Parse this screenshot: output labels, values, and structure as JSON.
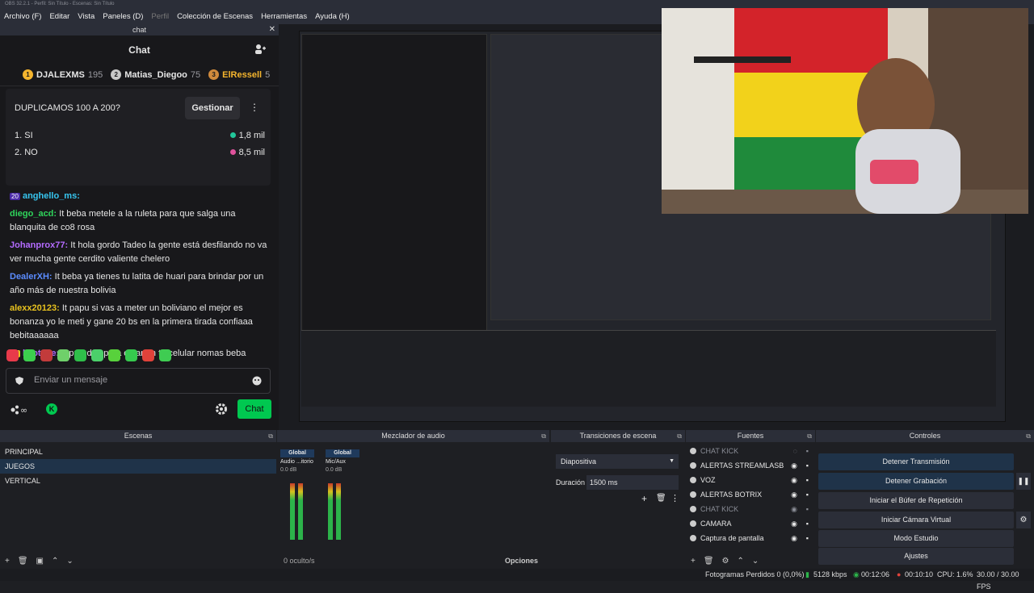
{
  "window_title": "OBS 32.2.1 - Perfil: Sin Título - Escenas: Sin Título",
  "menu": [
    "Archivo (F)",
    "Editar",
    "Vista",
    "Paneles (D)",
    "Perfil",
    "Colección de Escenas",
    "Herramientas",
    "Ayuda (H)"
  ],
  "chat_dock": {
    "dock_title": "chat",
    "header": "Chat",
    "leaderboard": [
      {
        "rank": "1",
        "name": "DJALEXMS",
        "points": "195",
        "color": "#f5b52e"
      },
      {
        "rank": "2",
        "name": "Matias_Diegoo",
        "points": "75",
        "color": "#c8c8c8"
      },
      {
        "rank": "3",
        "name": "ElRessell",
        "points": "5",
        "color": "#d08a3c"
      }
    ],
    "poll": {
      "question": "DUPLICAMOS 100 A 200?",
      "manage_label": "Gestionar",
      "options": [
        {
          "label": "1. SI",
          "value": "1,8 mil",
          "color": "#22c79a"
        },
        {
          "label": "2. NO",
          "value": "8,5 mil",
          "color": "#e0529c"
        }
      ]
    },
    "messages": [
      {
        "user": "anghello_ms:",
        "text": "",
        "color": "#37c6f0",
        "badge": "20"
      },
      {
        "user": "diego_acd:",
        "text": " It beba metele a la ruleta para que salga una blanquita de co8 rosa",
        "color": "#2fd45b"
      },
      {
        "user": "Johanprox77:",
        "text": " It hola gordo Tadeo la gente está desfilando no va ver mucha gente cerdito valiente chelero",
        "color": "#b46bff"
      },
      {
        "user": "DealerXH:",
        "text": " It beba ya tienes tu latita de huari para brindar por un año más de nuestra bolivia",
        "color": "#5b8cff"
      },
      {
        "user": "alexx20123:",
        "text": " It papu si vas a meter un boliviano el mejor es bonanza yo le meti y gane 20 bs en la primera tirada confiaaa bebitaaaaaa",
        "color": "#e8c21e"
      },
      {
        "user": "lajotape:",
        "text": " It prendes para estar en tu celular nomas beba",
        "color": "#b46bff",
        "badge": "17"
      }
    ],
    "input_placeholder": "Enviar un mensaje",
    "chat_button": "Chat"
  },
  "scenes": {
    "title": "Escenas",
    "items": [
      "PRINCIPAL",
      "JUEGOS",
      "VERTICAL"
    ],
    "active_index": 1
  },
  "mixer": {
    "title": "Mezclador de audio",
    "channels": [
      {
        "name": "Global",
        "source": "Audio ...itorio",
        "db": "0.0 dB"
      },
      {
        "name": "Global",
        "source": "Mic/Aux",
        "db": "0.0 dB"
      }
    ],
    "hidden": "0 oculto/s",
    "options_label": "Opciones"
  },
  "transitions": {
    "title": "Transiciones de escena",
    "selected": "Diapositiva",
    "duration_label": "Duración",
    "duration_value": "1500 ms"
  },
  "sources": {
    "title": "Fuentes",
    "items": [
      {
        "name": "CHAT KICK",
        "dim": true
      },
      {
        "name": "ALERTAS STREAMLASB",
        "dim": false
      },
      {
        "name": "VOZ",
        "dim": false
      },
      {
        "name": "ALERTAS BOTRIX",
        "dim": false
      },
      {
        "name": "CHAT KICK",
        "dim": true
      },
      {
        "name": "CAMARA",
        "dim": false
      },
      {
        "name": "Captura de pantalla",
        "dim": false
      }
    ]
  },
  "controls": {
    "title": "Controles",
    "buttons": [
      "Detener Transmisión",
      "Detener Grabación",
      "Iniciar el Búfer de Repetición",
      "Iniciar Cámara Virtual",
      "Modo Estudio",
      "Ajustes"
    ]
  },
  "status": {
    "dropped": "Fotogramas Perdidos 0 (0,0%)",
    "bitrate": "5128 kbps",
    "stream_time": "00:12:06",
    "rec_time": "00:10:10",
    "cpu": "CPU: 1.6%",
    "fps": "30.00 / 30.00 FPS"
  }
}
